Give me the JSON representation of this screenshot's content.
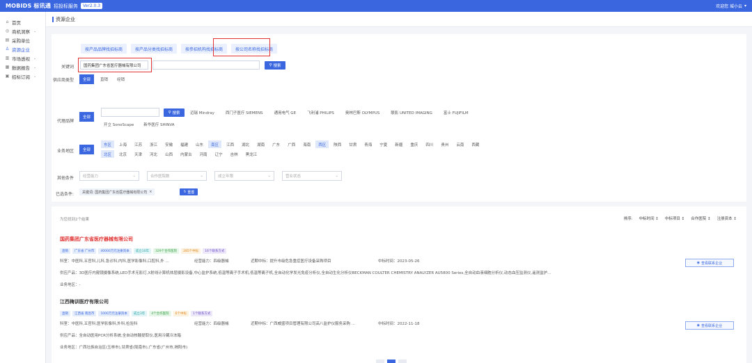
{
  "topbar": {
    "brand": "MOBIDS 标讯通",
    "subbrand": "招投标服务",
    "version": "Ver2.0.3",
    "user": "欢迎您 城小云"
  },
  "sidebar": {
    "items": [
      {
        "icon": "⌂",
        "label": "首页",
        "active": false,
        "expandable": false
      },
      {
        "icon": "◎",
        "label": "商机洞察",
        "active": false,
        "expandable": true
      },
      {
        "icon": "▤",
        "label": "采购单位",
        "active": false,
        "expandable": false
      },
      {
        "icon": "♙",
        "label": "资源企业",
        "active": true,
        "expandable": false
      },
      {
        "icon": "▥",
        "label": "市场透视",
        "active": false,
        "expandable": true
      },
      {
        "icon": "▦",
        "label": "数据报告",
        "active": false,
        "expandable": true
      },
      {
        "icon": "▣",
        "label": "招标订阅",
        "active": false,
        "expandable": true
      }
    ]
  },
  "page": {
    "title": "资源企业"
  },
  "filters": {
    "search_tabs": [
      "按产品品牌找招标商",
      "按产品分类找招标商",
      "按参招机构找招标商",
      "按公司名称找招标商"
    ],
    "keyword_label": "关键词",
    "keyword_value": "国药集团广东省医疗器械有限公司",
    "search_button": "搜索",
    "brand_search_button": "搜索",
    "company_type_label": "供应商类型",
    "company_types": [
      "全部",
      "直销",
      "经销"
    ],
    "brand_label": "代理品牌",
    "brand_all": "全部",
    "brands_row1": [
      "迈瑞 Mindray",
      "西门子医疗 SIEMENS",
      "通用电气 GE",
      "飞利浦 PHILIPS",
      "奥林巴斯 OLYMPUS",
      "联影 UNITED IMAGING",
      "富士 FUJIFILM"
    ],
    "brands_row2": [
      "开立 SonoScape",
      "新华医疗 SHINVA"
    ],
    "region_label": "业务地区",
    "region_all": "全部",
    "regions_row1": [
      "东区",
      "上海",
      "江苏",
      "浙江",
      "安徽",
      "福建",
      "山东",
      "南区",
      "江西",
      "湖北",
      "湖南",
      "广东",
      "广西",
      "海南",
      "西区",
      "陕西",
      "甘肃",
      "青海",
      "宁夏",
      "新疆",
      "重庆",
      "四川",
      "贵州",
      "云南",
      "西藏"
    ],
    "regions_row2": [
      "北区",
      "北京",
      "天津",
      "河北",
      "山西",
      "内蒙古",
      "河南",
      "辽宁",
      "吉林",
      "黑龙江"
    ],
    "other_label": "其他条件",
    "other_selects": [
      "经营能力",
      "合作医院数",
      "成立年限",
      "营业状态"
    ],
    "selected_label": "已选条件:",
    "selected_tag": "关键词: 国药集团广东省医疗器械有限公司",
    "reset_button": "重置"
  },
  "results": {
    "count_text": "为您找到2个结果",
    "sort_label": "排序:",
    "sort_options": [
      "中标时间 ↕",
      "中标项目 ↕",
      "合作医院 ↕",
      "注册资本 ↕"
    ],
    "cards": [
      {
        "name": "国药集团广东省医疗器械有限公司",
        "name_color": "#e03030",
        "tags": [
          {
            "text": "直销",
            "style": "t-blue"
          },
          {
            "text": "广东省 广州市",
            "style": "t-blue"
          },
          {
            "text": "40000万元注册资本",
            "style": "t-blue"
          },
          {
            "text": "成立10年",
            "style": "t-cyan"
          },
          {
            "text": "329个合作医院",
            "style": "t-green"
          },
          {
            "text": "285个中标",
            "style": "t-orange"
          },
          {
            "text": "16个联系方式",
            "style": "t-purple"
          }
        ],
        "line1": {
          "dept": "科室：中医科,五官科,儿科,急诊科,内科,医学影像科,口腔科,外 ...",
          "ability": "经营能力：四级器械",
          "recent": "近期中标：提升市级危急重症医疗设备采购项目",
          "time": "中标时间：2023-05-26"
        },
        "line2": "供应产品：3D医疗内窥镜摄像系统,LED手术无影灯,X射线计算机体层摄影设备,中心监护系统,低温等离子手术机,低温等离子机,全自动化学发光免疫分析仪,全自动生化分析仪BECKMAN COULTER CHEMISTRY ANALYZER AU5800 Series,全自动血液细胞分析仪,动态血压监测仪,遥测监护...",
        "line3": "业务地区：-",
        "detail_button": "查看联系企业"
      },
      {
        "name": "江西梅训医疗有限公司",
        "name_color": "#333333",
        "tags": [
          {
            "text": "直销",
            "style": "t-blue"
          },
          {
            "text": "江西省 南昌市",
            "style": "t-blue"
          },
          {
            "text": "1000万元注册资本",
            "style": "t-blue"
          },
          {
            "text": "成立3年",
            "style": "t-cyan"
          },
          {
            "text": "4个合作医院",
            "style": "t-green"
          },
          {
            "text": "6个中标",
            "style": "t-orange"
          },
          {
            "text": "1个联系方式",
            "style": "t-purple"
          }
        ],
        "line1": {
          "dept": "科室：中医科,五官科,医学影像科,外科,检验科",
          "ability": "经营能力：四级器械",
          "recent": "近期中标：广西威盛项目管理有限公司高八监护仪服务采购 ...",
          "time": "中标时间：2022-11-18"
        },
        "line2": "供应产品：全自动医用PCR分析系统,全自动核酸提取仪,医用冷藏冷冻箱",
        "line3": "业务地区：广西壮族自治区(玉林市),甘肃省(陇南市),广东省(广州市,揭阳市)",
        "detail_button": "查看联系企业"
      }
    ]
  },
  "colors": {
    "primary": "#3a67e0",
    "highlight": "#e03030"
  }
}
